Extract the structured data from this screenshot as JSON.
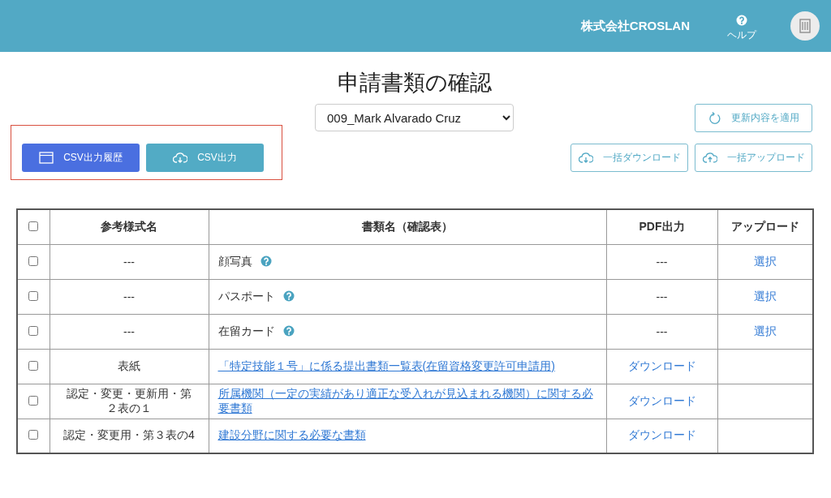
{
  "header": {
    "company": "株式会社CROSLAN",
    "help_label": "ヘルプ"
  },
  "page_title": "申請書類の確認",
  "applicant_select": {
    "value": "009_Mark Alvarado Cruz"
  },
  "buttons": [
    {
      "label": "更新内容を適用",
      "kind": "apply"
    },
    {
      "label": "CSV出力履歴",
      "kind": "history"
    },
    {
      "label": "CSV出力",
      "kind": "csv"
    },
    {
      "label": "一括ダウンロード",
      "kind": "download"
    },
    {
      "label": "一括アップロード",
      "kind": "upload"
    }
  ],
  "table": {
    "header_checked": false,
    "columns": [
      "参考様式名",
      "書類名（確認表）",
      "PDF出力",
      "アップロード"
    ],
    "rows": [
      {
        "checked": false,
        "form": "---",
        "document": {
          "kind": "text",
          "text": "顔写真"
        },
        "pdf": {
          "kind": "text",
          "text": "---"
        },
        "upload": "選択"
      },
      {
        "checked": false,
        "form": "---",
        "document": {
          "kind": "text",
          "text": "パスポート"
        },
        "pdf": {
          "kind": "text",
          "text": "---"
        },
        "upload": "選択"
      },
      {
        "checked": false,
        "form": "---",
        "document": {
          "kind": "text",
          "text": "在留カード"
        },
        "pdf": {
          "kind": "text",
          "text": "---"
        },
        "upload": "選択"
      },
      {
        "checked": false,
        "form": "表紙",
        "document": {
          "kind": "link",
          "text": "「特定技能１号」に係る提出書類一覧表(在留資格変更許可申請用)"
        },
        "pdf": {
          "kind": "link",
          "text": "ダウンロード"
        }
      },
      {
        "checked": false,
        "form": "認定・変更・更新用・第２表の１",
        "document": {
          "kind": "link",
          "text": "所属機関（一定の実績があり適正な受入れが見込まれる機関）に関する必要書類"
        },
        "pdf": {
          "kind": "link",
          "text": "ダウンロード"
        }
      },
      {
        "checked": false,
        "form": "認定・変更用・第３表の4",
        "document": {
          "kind": "link",
          "text": "建設分野に関する必要な書類"
        },
        "pdf": {
          "kind": "link",
          "text": "ダウンロード"
        }
      }
    ]
  }
}
